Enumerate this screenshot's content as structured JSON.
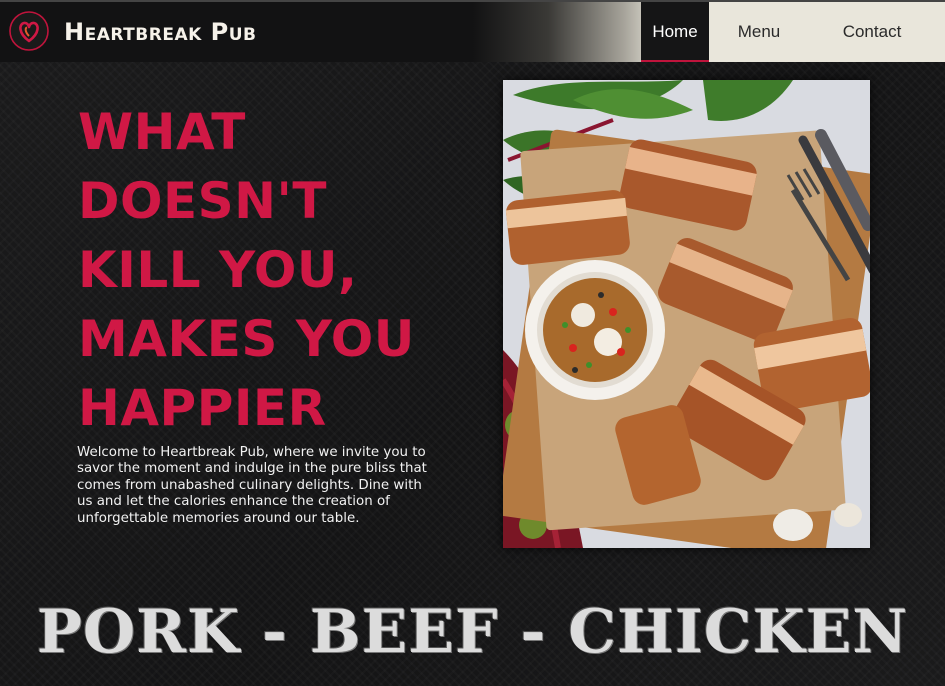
{
  "brand": {
    "name": "Heartbreak Pub",
    "logo_icon": "heart-logo-icon",
    "accent_color": "#d01845"
  },
  "nav": {
    "items": [
      {
        "label": "Home",
        "active": true
      },
      {
        "label": "Menu",
        "active": false
      },
      {
        "label": "Contact",
        "active": false
      }
    ]
  },
  "hero": {
    "headline_lines": [
      "What",
      "Doesn't",
      "Kill You,",
      "Makes You",
      "Happier"
    ],
    "intro": "Welcome to Heartbreak Pub, where we invite you to savor the moment and indulge in the pure bliss that comes from unabashed culinary delights. Dine with us and let the calories enhance the creation of unforgettable memories around our table."
  },
  "banner": {
    "text": "PORK - BEEF - CHICKEN"
  }
}
